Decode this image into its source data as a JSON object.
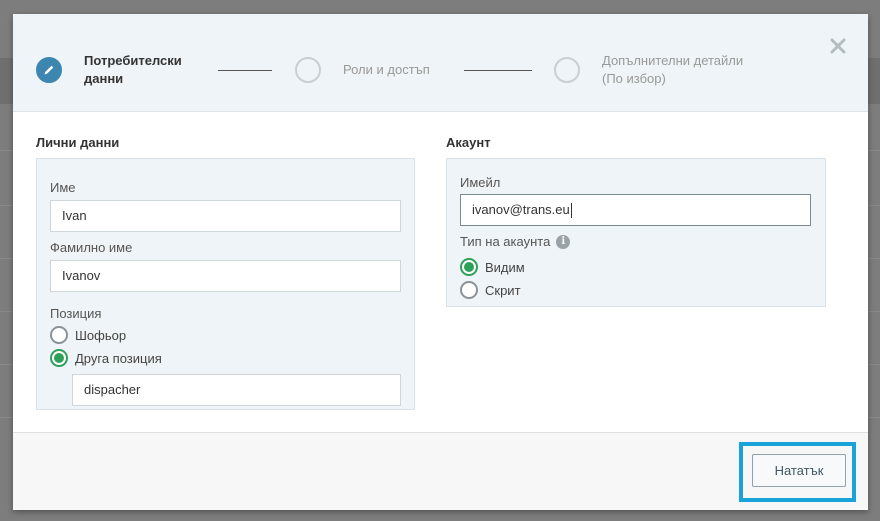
{
  "wizard": {
    "steps": [
      {
        "label_line1": "Потребителски",
        "label_line2": "данни",
        "state": "active"
      },
      {
        "label_line1": "Роли и достъп",
        "label_line2": "",
        "state": "pending"
      },
      {
        "label_line1": "Допълнителни детайли",
        "label_line2": "(По избор)",
        "state": "pending"
      }
    ],
    "close_icon": "close-icon",
    "edit_icon": "pencil-icon"
  },
  "personal": {
    "title": "Лични данни",
    "first_name_label": "Име",
    "first_name_value": "Ivan",
    "last_name_label": "Фамилно име",
    "last_name_value": "Ivanov",
    "position_label": "Позиция",
    "position_options": [
      "Шофьор",
      "Друга позиция"
    ],
    "position_selected": "Друга позиция",
    "other_position_value": "dispacher"
  },
  "account": {
    "title": "Акаунт",
    "email_label": "Имейл",
    "email_value": "ivanov@trans.eu",
    "type_label": "Тип на акаунта",
    "type_options": [
      "Видим",
      "Скрит"
    ],
    "type_selected": "Видим",
    "info_icon": "info-icon"
  },
  "footer": {
    "next_label": "Нататък"
  },
  "colors": {
    "accent": "#3d86b0",
    "radio_checked": "#2ea05a",
    "highlight": "#1aa3d8",
    "panel_bg": "#eef4f7"
  }
}
